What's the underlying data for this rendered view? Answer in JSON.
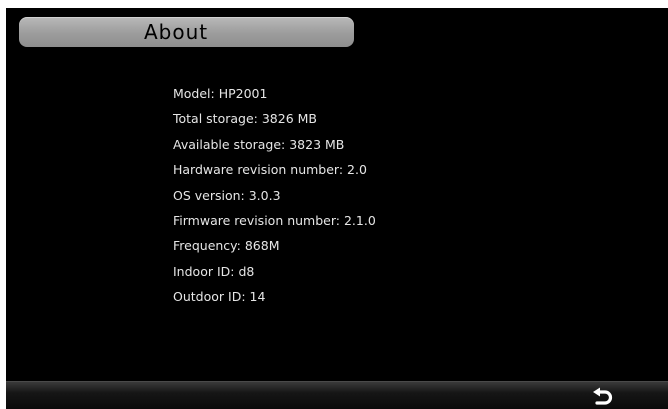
{
  "header": {
    "title": "About"
  },
  "info": [
    "Model: HP2001",
    "Total storage: 3826 MB",
    "Available storage: 3823 MB",
    "Hardware revision number: 2.0",
    "OS version: 3.0.3",
    "Firmware revision number: 2.1.0",
    "Frequency: 868M",
    "Indoor ID: d8",
    "Outdoor ID: 14"
  ],
  "footer": {
    "back_icon": "return-arrow-icon"
  },
  "colors": {
    "background": "#000000",
    "title_pill": "#a8a8a8",
    "text": "#e6e6e6"
  }
}
